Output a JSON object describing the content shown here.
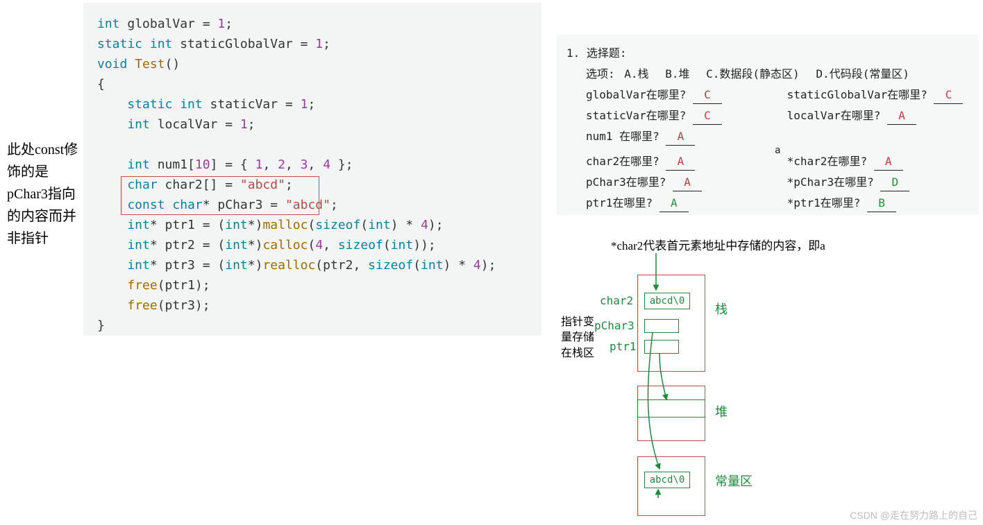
{
  "left_note": "此处const修饰的是pChar3指向的内容而并非指针",
  "code": {
    "l1a": "int",
    "l1b": " globalVar = ",
    "l1c": "1",
    "l1d": ";",
    "l2a": "static int",
    "l2b": " staticGlobalVar = ",
    "l2c": "1",
    "l2d": ";",
    "l3a": "void",
    "l3b": " ",
    "l3c": "Test",
    "l3d": "()",
    "l4": "{",
    "l5a": "    static int",
    "l5b": " staticVar = ",
    "l5c": "1",
    "l5d": ";",
    "l6a": "    int",
    "l6b": " localVar = ",
    "l6c": "1",
    "l6d": ";",
    "l7": "",
    "l8a": "    int",
    "l8b": " num1[",
    "l8c": "10",
    "l8d": "] = { ",
    "l8e": "1",
    "l8f": ", ",
    "l8g": "2",
    "l8h": ", ",
    "l8i": "3",
    "l8j": ", ",
    "l8k": "4",
    "l8l": " };",
    "l9a": "    char",
    "l9b": " char2[] = ",
    "l9c": "\"abcd\"",
    "l9d": ";",
    "l10a": "    const char",
    "l10b": "* pChar3 = ",
    "l10c": "\"abcd\"",
    "l10d": ";",
    "l11a": "    int",
    "l11b": "* ptr1 = (",
    "l11c": "int",
    "l11d": "*)",
    "l11e": "malloc",
    "l11f": "(",
    "l11g": "sizeof",
    "l11h": "(",
    "l11i": "int",
    "l11j": ") * ",
    "l11k": "4",
    "l11l": ");",
    "l12a": "    int",
    "l12b": "* ptr2 = (",
    "l12c": "int",
    "l12d": "*)",
    "l12e": "calloc",
    "l12f": "(",
    "l12g": "4",
    "l12h": ", ",
    "l12i": "sizeof",
    "l12j": "(",
    "l12k": "int",
    "l12l": "));",
    "l13a": "    int",
    "l13b": "* ptr3 = (",
    "l13c": "int",
    "l13d": "*)",
    "l13e": "realloc",
    "l13f": "(ptr2, ",
    "l13g": "sizeof",
    "l13h": "(",
    "l13i": "int",
    "l13j": ") * ",
    "l13k": "4",
    "l13l": ");",
    "l14a": "    ",
    "l14b": "free",
    "l14c": "(ptr1);",
    "l15a": "    ",
    "l15b": "free",
    "l15c": "(ptr3);",
    "l16": "}"
  },
  "quiz": {
    "header_num": "1.",
    "header_title": "选择题:",
    "options_label": "选项:",
    "optA": "A.栈",
    "optB": "B.堆",
    "optC": "C.数据段(静态区)",
    "optD": "D.代码段(常量区)",
    "q1": "globalVar在哪里?",
    "a1": "C",
    "q2": "staticGlobalVar在哪里?",
    "a2": "C",
    "q3": "staticVar在哪里?",
    "a3": "C",
    "q4": "localVar在哪里?",
    "a4": "A",
    "q5": "num1 在哪里?",
    "a5": "A",
    "q6": "char2在哪里?",
    "a6": "A",
    "q6note": "a",
    "q7": "*char2在哪里?",
    "a7": "A",
    "q8": "pChar3在哪里?",
    "a8": "A",
    "q9": "*pChar3在哪里?",
    "a9": "D",
    "q10": "ptr1在哪里?",
    "a10": "A",
    "q11": "*ptr1在哪里?",
    "a11": "B"
  },
  "diagram": {
    "top_note": "*char2代表首元素地址中存储的内容，即a",
    "char2_label": "char2",
    "char2_content": "abcd\\0",
    "pChar3_label": "pChar3",
    "ptr1_label": "ptr1",
    "region_stack": "栈",
    "region_heap": "堆",
    "region_const": "常量区",
    "side_note": "指针变量存储在栈区",
    "const_content": "abcd\\0"
  },
  "watermark": "CSDN @走在努力路上的自己"
}
